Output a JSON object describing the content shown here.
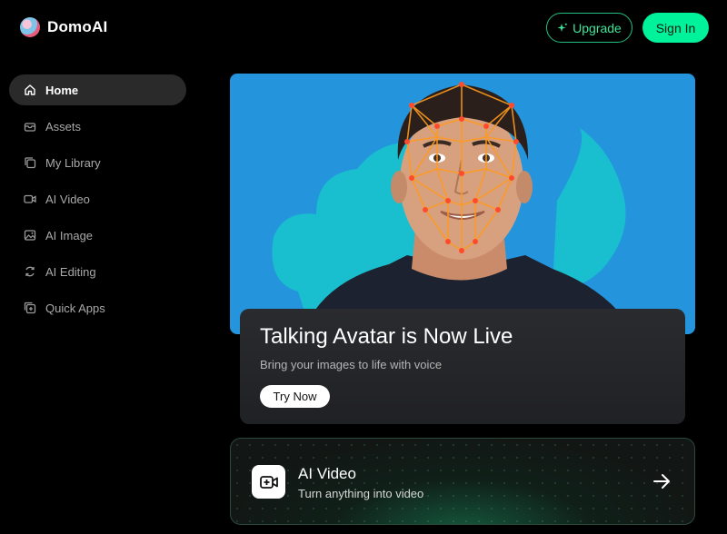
{
  "header": {
    "logo_text": "DomoAI",
    "upgrade_label": "Upgrade",
    "signin_label": "Sign In",
    "accent_color": "#00f29a"
  },
  "sidebar": {
    "items": [
      {
        "label": "Home",
        "icon": "home-icon",
        "active": true
      },
      {
        "label": "Assets",
        "icon": "assets-icon",
        "active": false
      },
      {
        "label": "My Library",
        "icon": "library-icon",
        "active": false
      },
      {
        "label": "AI Video",
        "icon": "video-icon",
        "active": false
      },
      {
        "label": "AI Image",
        "icon": "image-icon",
        "active": false
      },
      {
        "label": "AI Editing",
        "icon": "editing-icon",
        "active": false
      },
      {
        "label": "Quick Apps",
        "icon": "apps-icon",
        "active": false
      }
    ]
  },
  "hero": {
    "title": "Talking Avatar is Now Live",
    "subtitle": "Bring your images to life with voice",
    "button_label": "Try Now"
  },
  "feature_card": {
    "title": "AI Video",
    "subtitle": "Turn anything into video",
    "icon": "video-plus-icon"
  }
}
